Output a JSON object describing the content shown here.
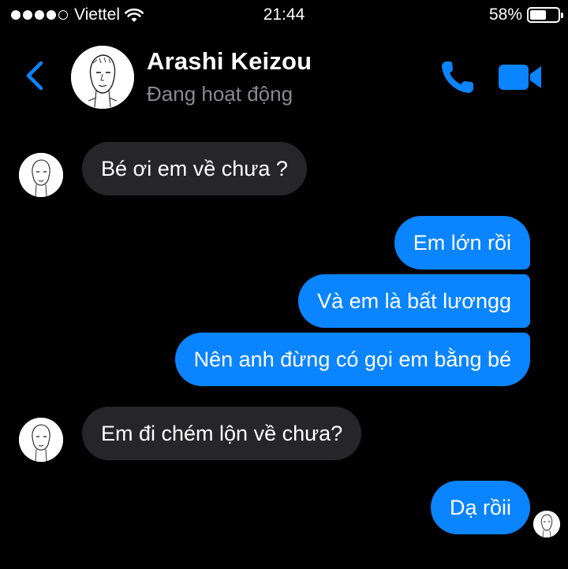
{
  "status_bar": {
    "carrier": "Viettel",
    "signal_bars": 4,
    "signal_total": 5,
    "time": "21:44",
    "battery": "58%",
    "battery_level": 0.58
  },
  "header": {
    "name": "Arashi Keizou",
    "status": "Đang hoạt động",
    "accent_color": "#0a84ff",
    "icons": [
      "back-chevron-icon",
      "avatar",
      "phone-icon",
      "video-camera-icon"
    ]
  },
  "messages": [
    {
      "from": "contact",
      "text": "Bé ơi em về chưa ?"
    },
    {
      "from": "me",
      "text": "Em lớn rồi"
    },
    {
      "from": "me",
      "text": "Và em là bất lươngg"
    },
    {
      "from": "me",
      "text": "Nên anh đừng có gọi em bằng bé"
    },
    {
      "from": "contact",
      "text": "Em đi chém lộn về chưa?"
    },
    {
      "from": "me",
      "text": "Dạ rồii"
    }
  ],
  "colors": {
    "background": "#000000",
    "incoming_bubble": "#262628",
    "outgoing_bubble": "#0a84ff",
    "secondary_text": "#8a8a8e"
  }
}
